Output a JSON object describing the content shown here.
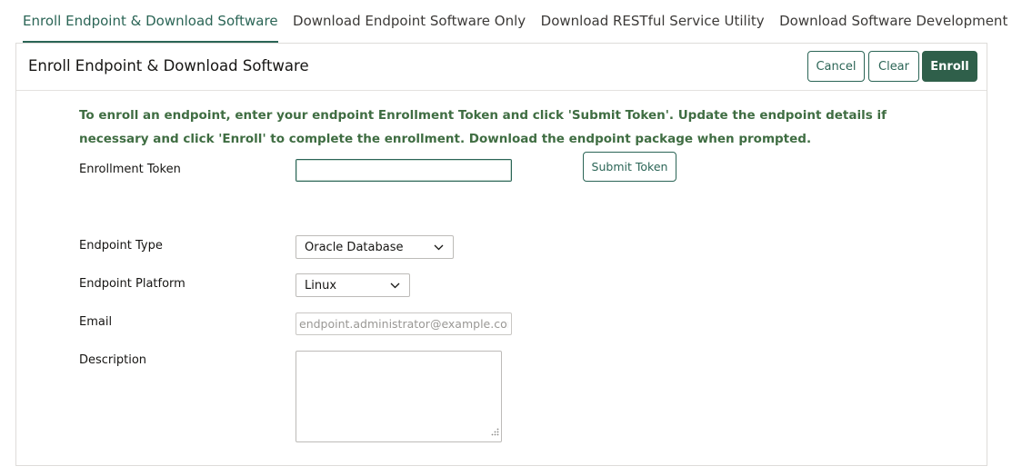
{
  "tabs": [
    {
      "label": "Enroll Endpoint & Download Software",
      "active": true
    },
    {
      "label": "Download Endpoint Software Only",
      "active": false
    },
    {
      "label": "Download RESTful Service Utility",
      "active": false
    },
    {
      "label": "Download Software Development Kit",
      "active": false
    }
  ],
  "panel": {
    "title": "Enroll Endpoint & Download Software",
    "buttons": {
      "cancel": "Cancel",
      "clear": "Clear",
      "enroll": "Enroll"
    }
  },
  "form": {
    "instructions": "To enroll an endpoint, enter your endpoint Enrollment Token and click 'Submit Token'. Update the endpoint details if necessary and click 'Enroll' to complete the enrollment. Download the endpoint package when prompted.",
    "token": {
      "label": "Enrollment Token",
      "value": "",
      "submit_label": "Submit Token"
    },
    "endpoint_type": {
      "label": "Endpoint Type",
      "value": "Oracle Database"
    },
    "endpoint_platform": {
      "label": "Endpoint Platform",
      "value": "Linux"
    },
    "email": {
      "label": "Email",
      "value": "",
      "placeholder": "endpoint.administrator@example.com"
    },
    "description": {
      "label": "Description",
      "value": ""
    }
  },
  "colors": {
    "accent": "#2b6556",
    "primary_button": "#2f5f4a",
    "instruction_text": "#3f6d42"
  },
  "icons": {
    "select_arrow": "chevron-down-icon",
    "resize": "resize-handle-icon"
  }
}
